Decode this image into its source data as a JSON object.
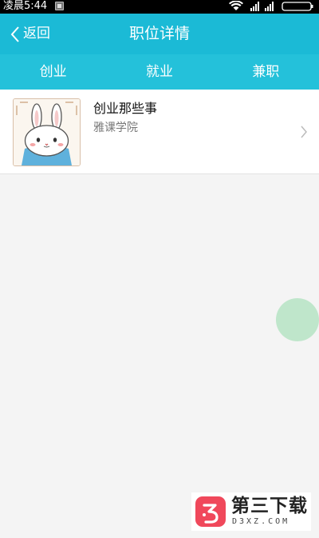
{
  "status_bar": {
    "time": "凌晨5:44",
    "icons": [
      "notification-icon",
      "wifi-icon",
      "signal-icon",
      "signal-icon",
      "battery-icon"
    ]
  },
  "header": {
    "back_label": "返回",
    "title": "职位详情",
    "color": "#1bbad6"
  },
  "tabs": [
    {
      "label": "创业"
    },
    {
      "label": "就业"
    },
    {
      "label": "兼职"
    }
  ],
  "list": {
    "items": [
      {
        "title": "创业那些事",
        "subtitle": "雅课学院",
        "thumbnail": "bunny-illustration"
      }
    ]
  },
  "fab": {
    "color": "#bfe6cb"
  },
  "watermark": {
    "text": "第三下载",
    "domain": "D3XZ.COM",
    "logo_color": "#f0485b"
  }
}
